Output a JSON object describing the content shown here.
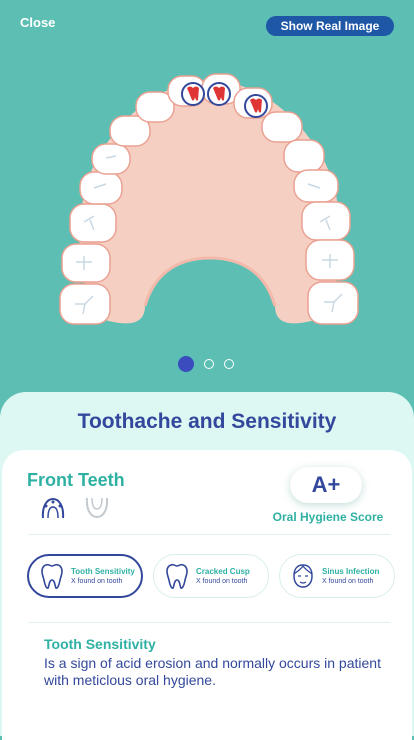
{
  "header": {
    "close_label": "Close",
    "show_real_label": "Show Real Image"
  },
  "colors": {
    "background": "#5dbfb4",
    "primary_navy": "#33489c",
    "teal_text": "#2eb1a3",
    "gum": "#f6cfc3",
    "button_blue": "#1e57a5",
    "marker_red": "#e03535"
  },
  "carousel": {
    "pages": 3,
    "active_index": 0
  },
  "sheet": {
    "title": "Toothache and Sensitivity",
    "region_title": "Front Teeth",
    "arch_icons": [
      "upper-arch-icon",
      "lower-arch-icon"
    ],
    "grade": "A+",
    "grade_label": "Oral Hygiene Score",
    "findings": [
      {
        "name": "Tooth Sensitivity",
        "count_text": "X found on tooth",
        "icon": "tooth-outline-icon",
        "active": true
      },
      {
        "name": "Cracked Cusp",
        "count_text": "X found on tooth",
        "icon": "tooth-outline-icon",
        "active": false
      },
      {
        "name": "Sinus Infection",
        "count_text": "X found on tooth",
        "icon": "face-icon",
        "active": false
      }
    ],
    "info": {
      "title": "Tooth Sensitivity",
      "description": "Is a sign of acid erosion and normally occurs in patient with meticlous oral hygiene."
    }
  }
}
